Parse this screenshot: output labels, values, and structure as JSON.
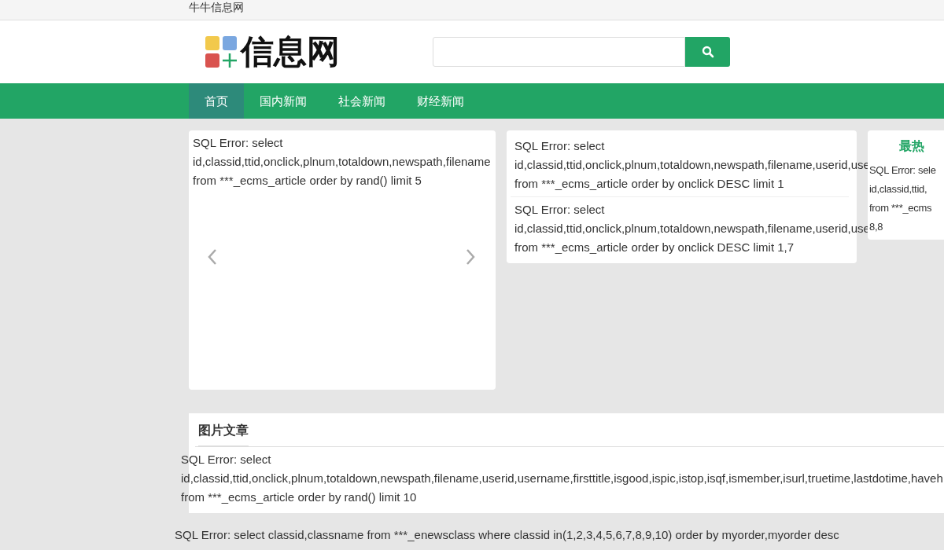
{
  "top_bar": {
    "site_name": "牛牛信息网"
  },
  "header": {
    "logo_text": "信息网"
  },
  "nav": [
    {
      "label": "首页",
      "selected": true
    },
    {
      "label": "国内新闻",
      "selected": false
    },
    {
      "label": "社会新闻",
      "selected": false
    },
    {
      "label": "财经新闻",
      "selected": false
    }
  ],
  "slider_card": {
    "lines": [
      "SQL Error: select",
      "id,classid,ttid,onclick,plnum,totaldown,newspath,filename",
      "from ***_ecms_article order by rand() limit 5"
    ]
  },
  "top_news_card": {
    "items": [
      {
        "lines": [
          "SQL Error: select",
          "id,classid,ttid,onclick,plnum,totaldown,newspath,filename,userid,use",
          "from ***_ecms_article order by onclick DESC limit 1"
        ]
      },
      {
        "lines": [
          "SQL Error: select",
          "id,classid,ttid,onclick,plnum,totaldown,newspath,filename,userid,use",
          "from ***_ecms_article order by onclick DESC limit 1,7"
        ]
      }
    ]
  },
  "hot_card": {
    "title": "最热",
    "lines": [
      "SQL Error: sele",
      "id,classid,ttid,",
      "from ***_ecms",
      "8,8"
    ]
  },
  "picture_section": {
    "title": "图片文章",
    "lines": [
      "SQL Error: select",
      "id,classid,ttid,onclick,plnum,totaldown,newspath,filename,userid,username,firsttitle,isgood,ispic,istop,isqf,ismember,isurl,truetime,lastdotime,haveh",
      "from ***_ecms_article order by rand() limit 10"
    ]
  },
  "footer_error": "SQL Error: select classid,classname from ***_enewsclass where classid in(1,2,3,4,5,6,7,8,9,10) order by myorder,myorder desc"
}
